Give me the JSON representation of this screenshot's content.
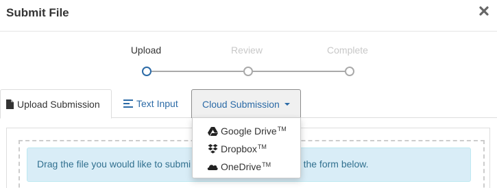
{
  "header": {
    "title": "Submit File",
    "close_icon": "close-icon"
  },
  "stepper": {
    "steps": [
      {
        "label": "Upload",
        "state": "active"
      },
      {
        "label": "Review",
        "state": "inactive"
      },
      {
        "label": "Complete",
        "state": "inactive"
      }
    ],
    "active_color": "#2b6aa6",
    "inactive_color": "#c8c8c8"
  },
  "tabs": {
    "upload": {
      "label": "Upload Submission",
      "icon": "file-icon"
    },
    "text": {
      "label": "Text Input",
      "icon": "lines-icon"
    },
    "cloud": {
      "label": "Cloud Submission",
      "icon": "caret-down-icon"
    }
  },
  "dropdown": {
    "items": [
      {
        "label": "Google Drive",
        "tm": "TM",
        "icon": "google-drive-icon"
      },
      {
        "label": "Dropbox",
        "tm": "TM",
        "icon": "dropbox-icon"
      },
      {
        "label": "OneDrive",
        "tm": "TM",
        "icon": "onedrive-icon"
      }
    ]
  },
  "alert": {
    "text_before": "Drag the file you would like to submi",
    "text_after": "fill out the form below.",
    "bg_color": "#d9edf7"
  }
}
